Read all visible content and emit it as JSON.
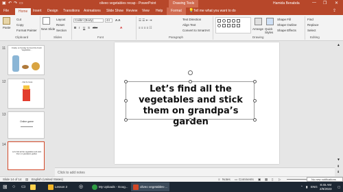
{
  "titlebar": {
    "doc_title": "oliveo vegetables recap - PowerPoint",
    "drawing_tools": "Drawing Tools",
    "user_name": "Hamida Benabda",
    "minimize": "—",
    "restore": "❐",
    "close": "✕"
  },
  "tabs": [
    "File",
    "Home",
    "Insert",
    "Design",
    "Transitions",
    "Animations",
    "Slide Show",
    "Review",
    "View",
    "Help",
    "Format"
  ],
  "tell_me": "Tell me what you want to do",
  "ribbon": {
    "paste": "Paste",
    "cut": "Cut",
    "copy": "Copy",
    "format_painter": "Format Painter",
    "clipboard": "Clipboard",
    "new_slide": "New Slide",
    "layout": "Layout",
    "reset": "Reset",
    "section": "Section",
    "slides": "Slides",
    "font_name": "Calibri (Body)",
    "font_size": "44",
    "font": "Font",
    "text_direction": "Text Direction",
    "align_text": "Align Text",
    "convert_smartart": "Convert to SmartArt",
    "paragraph": "Paragraph",
    "arrange": "Arrange",
    "quick_styles": "Quick Styles",
    "shape_fill": "Shape Fill",
    "shape_outline": "Shape Outline",
    "shape_effects": "Shape Effects",
    "drawing": "Drawing",
    "find": "Find",
    "replace": "Replace",
    "select": "Select",
    "editing": "Editing"
  },
  "thumbnails": [
    {
      "num": "11",
      "text": "Finally, on Sunday he found the Fresh Vegetables..."
    },
    {
      "num": "12",
      "text": "...that he loves"
    },
    {
      "num": "13",
      "text": "Online game"
    },
    {
      "num": "14",
      "text": "Let's find all the vegetables and stick them on grandpa's garden"
    }
  ],
  "slide": {
    "text": "Let’s find all the vegetables and stick them on grandpa’s garden"
  },
  "notes_placeholder": "Click to add notes",
  "status": {
    "slide_of": "Slide 14 of 14",
    "language": "English (United States)",
    "notes": "Notes",
    "comments": "Comments",
    "zoom": "60%"
  },
  "taskbar": {
    "lesson": "Lesson 2",
    "chrome": "My Uploads - Goog...",
    "powerpoint": "oliveo vegetables-...",
    "language": "ENG",
    "time": "8:45 AM",
    "date": "2/9/2023"
  },
  "toast": "No new notifications",
  "colors": {
    "accent": "#b7472a",
    "selected_thumb": "#d24726",
    "taskbar": "#1c2733"
  }
}
